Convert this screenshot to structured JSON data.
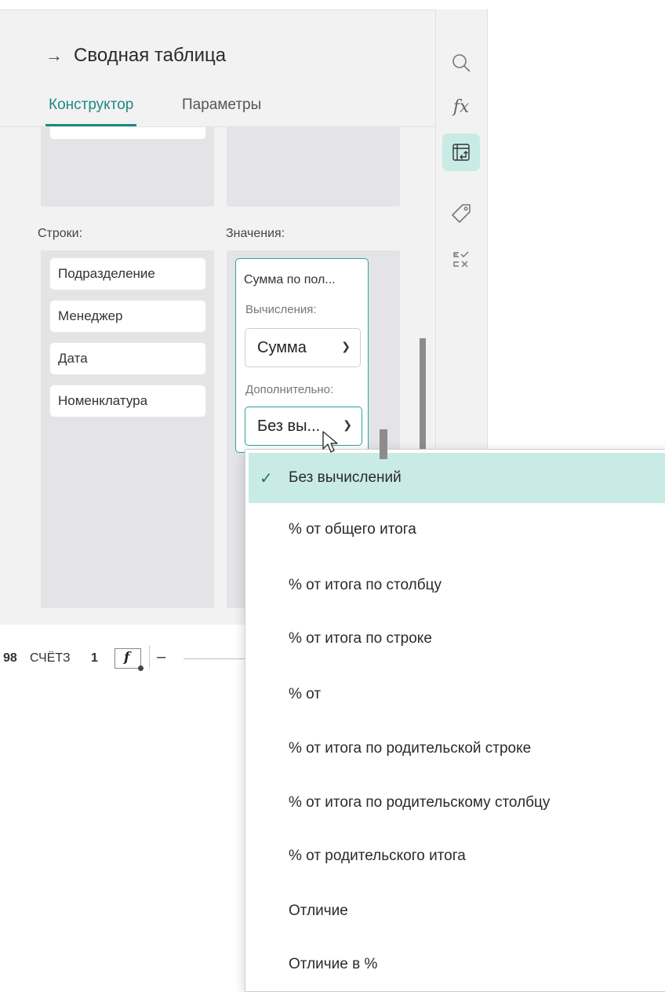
{
  "panel": {
    "title": "Сводная таблица",
    "tabs": [
      {
        "label": "Конструктор",
        "active": true
      },
      {
        "label": "Параметры",
        "active": false
      }
    ],
    "rows_label": "Строки:",
    "values_label": "Значения:",
    "rows_fields": [
      "Подразделение",
      "Менеджер",
      "Дата",
      "Номенклатура"
    ],
    "value_card": {
      "title": "Сумма по пол...",
      "calc_label": "Вычисления:",
      "calc_value": "Сумма",
      "extra_label": "Дополнительно:",
      "extra_value": "Без вы..."
    }
  },
  "toolbar": {
    "icons": [
      "search-icon",
      "formula-icon",
      "pivot-table-icon",
      "tag-icon",
      "list-check-icon"
    ],
    "formula_text": "fx"
  },
  "statusbar": {
    "left_number": "98",
    "sheet": "СЧЁТЗ",
    "count": "1",
    "function_glyph": "f",
    "minus": "–"
  },
  "dropdown": {
    "selected_index": 0,
    "items": [
      "Без вычислений",
      "% от общего итога",
      "% от итога по столбцу",
      "% от итога по строке",
      "% от",
      "% от итога по родительской строке",
      "% от итога по родительскому столбцу",
      "% от родительского итога",
      "Отличие",
      "Отличие в %"
    ]
  },
  "colors": {
    "accent": "#1c8a80",
    "selected_bg": "#c9ebe6",
    "panel_bg": "#f2f2f3"
  }
}
